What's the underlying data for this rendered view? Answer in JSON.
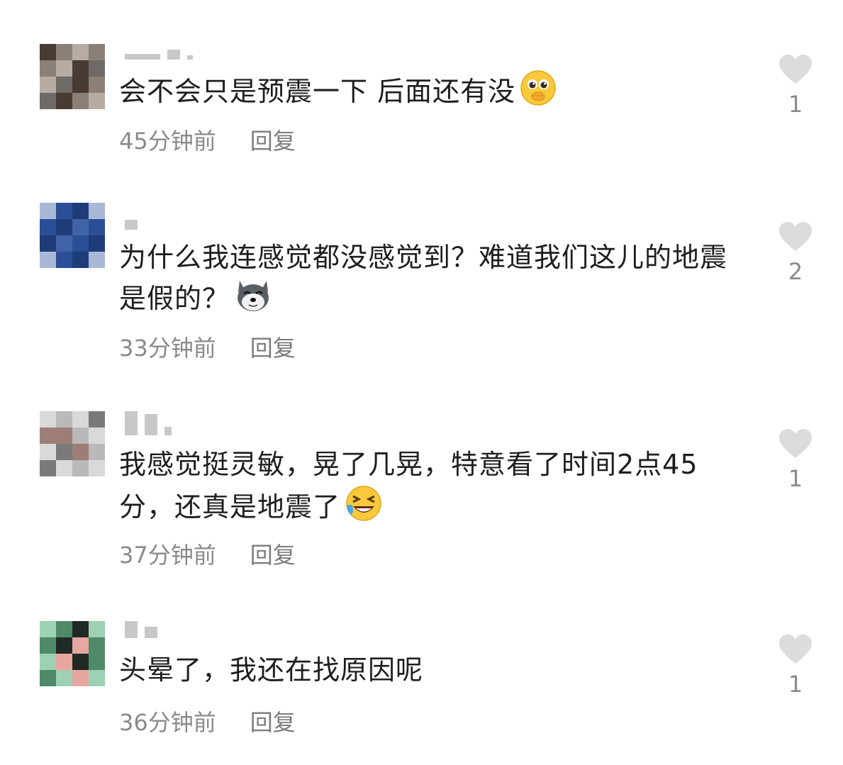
{
  "comments": [
    {
      "text": "会不会只是预震一下 后面还有没",
      "emoji": "pleading-face-icon",
      "time": "45分钟前",
      "reply_label": "回复",
      "likes": "1",
      "avatar_palette": [
        "#4a3a34",
        "#8a8078",
        "#b8aca2",
        "#6e6a66"
      ]
    },
    {
      "text": "为什么我连感觉都没感觉到？难道我们这儿的地震是假的？",
      "emoji": "husky-dog-icon",
      "time": "33分钟前",
      "reply_label": "回复",
      "likes": "2",
      "avatar_palette": [
        "#1e3c78",
        "#2b4f96",
        "#3f63a6",
        "#a9b8d6"
      ]
    },
    {
      "text": "我感觉挺灵敏，晃了几晃，特意看了时间2点45分，还真是地震了",
      "emoji": "rolling-laughing-icon",
      "time": "37分钟前",
      "reply_label": "回复",
      "likes": "1",
      "avatar_palette": [
        "#b9b9b9",
        "#9d7e76",
        "#d9d9d9",
        "#7a7a7a"
      ]
    },
    {
      "text": "头晕了，我还在找原因呢",
      "emoji": "",
      "time": "36分钟前",
      "reply_label": "回复",
      "likes": "1",
      "avatar_palette": [
        "#9ed0b4",
        "#4f8a68",
        "#1f2a25",
        "#e8a6a0"
      ]
    }
  ]
}
